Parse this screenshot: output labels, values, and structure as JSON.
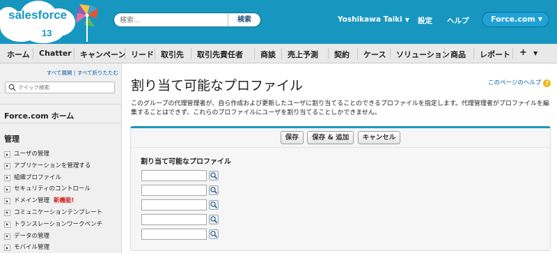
{
  "header": {
    "logo_text": "salesforce",
    "logo_version": "13",
    "search_placeholder": "検索...",
    "search_button": "検索",
    "user_name": "Yoshikawa Taiki",
    "setup_link": "設定",
    "help_link": "ヘルプ",
    "app_menu": "Force.com",
    "brand_color": "#1797c0"
  },
  "tabs": [
    "ホーム",
    "Chatter",
    "キャンペーン",
    "リード",
    "取引先",
    "取引先責任者",
    "商談",
    "売上予測",
    "契約",
    "ケース",
    "ソリューション",
    "商品",
    "レポート"
  ],
  "tabs_plus": "+",
  "sidebar": {
    "expand_all": "すべて展開",
    "collapse_all": "すべて折りたたむ",
    "toggle_separator": "|",
    "quick_search_placeholder": "クイック検索",
    "home_link": "Force.com ホーム",
    "admin_title": "管理",
    "items": [
      {
        "label": "ユーザの管理"
      },
      {
        "label": "アプリケーションを管理する"
      },
      {
        "label": "組織プロファイル"
      },
      {
        "label": "セキュリティのコントロール"
      },
      {
        "label": "ドメイン管理",
        "badge": "新機能!"
      },
      {
        "label": "コミュニケーションテンプレート"
      },
      {
        "label": "トランスレーションワークベンチ"
      },
      {
        "label": "データの管理"
      },
      {
        "label": "モバイル管理"
      }
    ]
  },
  "main": {
    "title": "割り当て可能なプロファイル",
    "help_text": "このページのヘルプ",
    "description": "このグループの代理管理者が、自ら作成および更新したユーザに割り当てることのできるプロファイルを指定します。代理管理者がプロファイルを編集することはできず、これらのプロファイルにユーザを割り当てることしかできません。",
    "buttons": {
      "save": "保存",
      "save_new": "保存 & 追加",
      "cancel": "キャンセル"
    },
    "section_label": "割り当て可能なプロファイル",
    "profile_fields": [
      "",
      "",
      "",
      "",
      ""
    ]
  }
}
